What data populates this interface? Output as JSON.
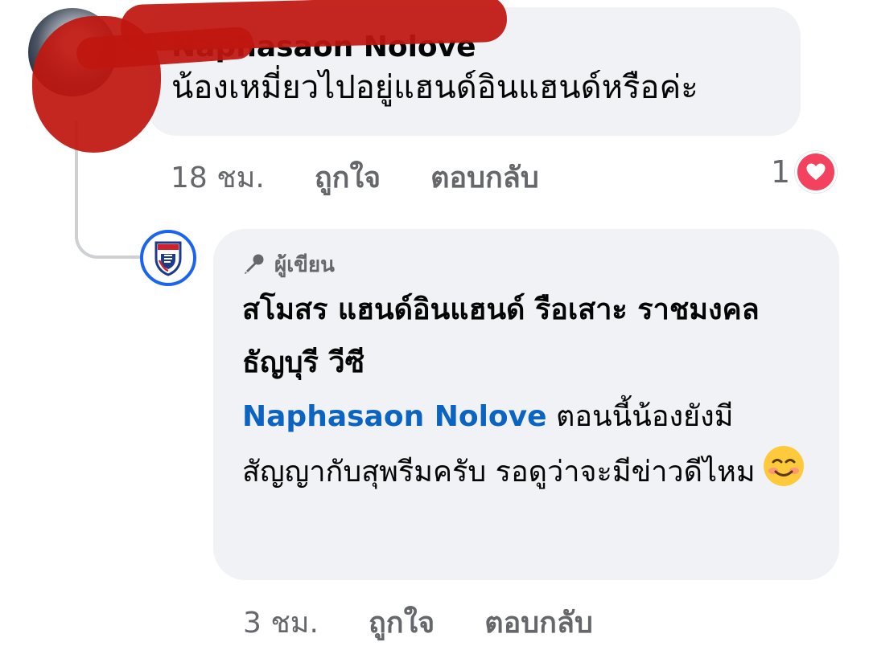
{
  "comment": {
    "author": "Naphasaon Nolove",
    "text": "น้องเหมี่ยวไปอยู่แฮนด์อินแฮนด์หรือค่ะ",
    "time": "18 ชม.",
    "like_label": "ถูกใจ",
    "reply_label": "ตอบกลับ",
    "reaction_count": "1",
    "reaction_icon": "heart-icon",
    "reaction_color": "#f3425f"
  },
  "reply": {
    "badge_label": "ผู้เขียน",
    "badge_icon": "microphone-icon",
    "author": "สโมสร แฮนด์อินแฮนด์ รือเสาะ ราชมงคลธัญบุรี วีซี",
    "mention": "Naphasaon Nolove",
    "text": " ตอนนี้น้องยังมีสัญญากับสุพรีมครับ รอดูว่าจะมีข่าวดีไหม",
    "emoji": "smiling-face-icon",
    "time": "3 ชม.",
    "like_label": "ถูกใจ",
    "reply_label": "ตอบกลับ",
    "mention_color": "#0b64c2",
    "avatar_ring_color": "#1b64f2"
  }
}
